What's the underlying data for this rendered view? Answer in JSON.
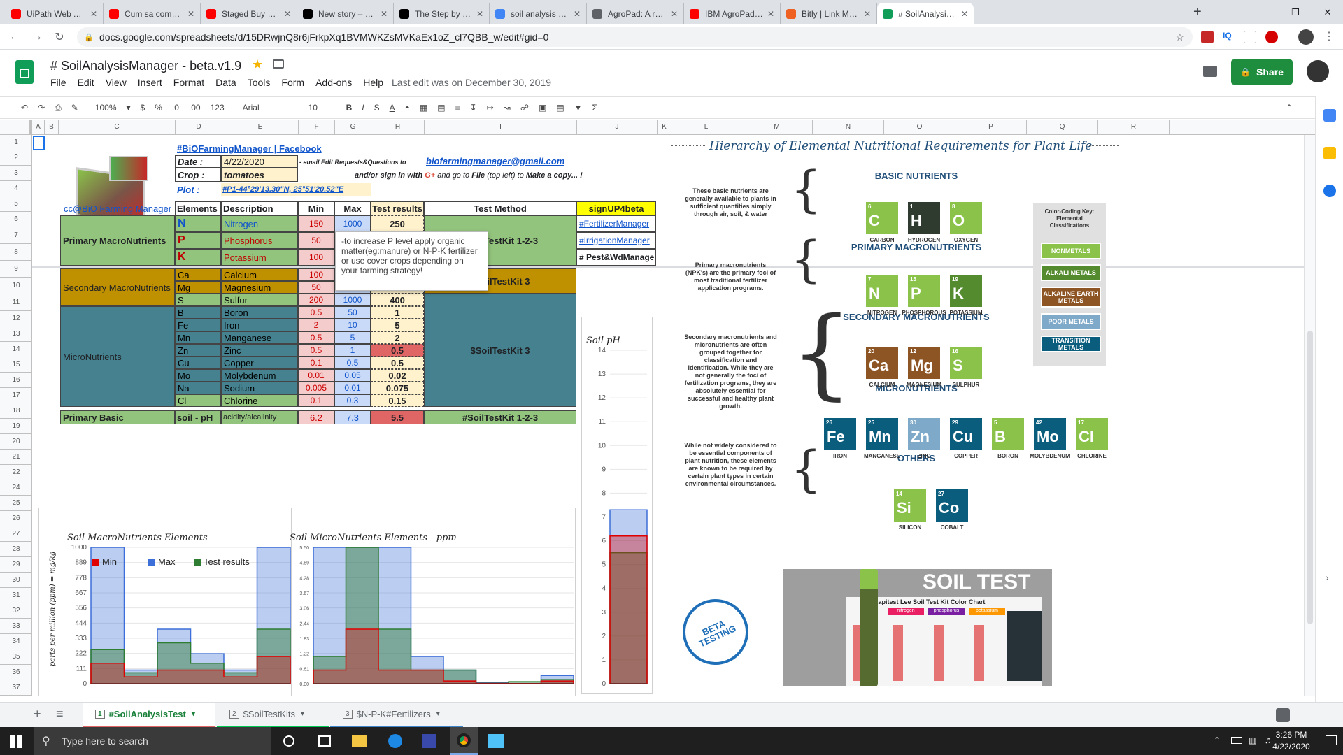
{
  "browser": {
    "tabs": [
      {
        "title": "UiPath Web Autom",
        "icon": "youtube-icon",
        "color": "#ff0000"
      },
      {
        "title": "Cum sa compui Un",
        "icon": "youtube-icon",
        "color": "#ff0000"
      },
      {
        "title": "Staged Buy Out- He",
        "icon": "youtube-icon",
        "color": "#ff0000"
      },
      {
        "title": "New story – Mediur",
        "icon": "medium-icon",
        "color": "#000000"
      },
      {
        "title": "The Step by Step Bl",
        "icon": "medium-icon",
        "color": "#000000"
      },
      {
        "title": "soil analysis – Căuta",
        "icon": "google-icon",
        "color": "#4285f4"
      },
      {
        "title": "AgroPad: A real-tim",
        "icon": "globe-icon",
        "color": "#5f6368"
      },
      {
        "title": "IBM AgroPad - AI-p",
        "icon": "youtube-icon",
        "color": "#ff0000"
      },
      {
        "title": "Bitly | Link Manager",
        "icon": "bitly-icon",
        "color": "#ee6123"
      },
      {
        "title": "# SoilAnalysisMana",
        "icon": "sheets-icon",
        "color": "#0f9d58"
      }
    ],
    "url": "docs.google.com/spreadsheets/d/15DRwjnQ8r6jFrkpXq1BVMWKZsMVKaEx1oZ_cl7QBB_w/edit#gid=0"
  },
  "doc": {
    "title": "# SoilAnalysisManager - beta.v1.9",
    "menus": [
      "File",
      "Edit",
      "View",
      "Insert",
      "Format",
      "Data",
      "Tools",
      "Form",
      "Add-ons",
      "Help"
    ],
    "last_edit": "Last edit was on December 30, 2019",
    "share": "Share"
  },
  "toolbar": {
    "zoom": "100%",
    "currency": "$",
    "percent": "%",
    "dec0": ".0",
    "dec00": ".00",
    "fmt": "123",
    "font": "Arial",
    "size": "10"
  },
  "columns": [
    "A",
    "B",
    "C",
    "D",
    "E",
    "F",
    "G",
    "H",
    "I",
    "J",
    "K",
    "L",
    "M",
    "N",
    "O",
    "P",
    "Q",
    "R"
  ],
  "rows": [
    "1",
    "2",
    "3",
    "4",
    "5",
    "6",
    "7",
    "8",
    "9",
    "10",
    "11",
    "12",
    "13",
    "14",
    "15",
    "16",
    "17",
    "18",
    "19",
    "20",
    "21",
    "22",
    "24",
    "25",
    "26",
    "27",
    "28",
    "29",
    "30",
    "31",
    "32",
    "33",
    "34",
    "35",
    "36",
    "37"
  ],
  "info": {
    "fb": "#BiOFarmingManager | Facebook",
    "date_label": "Date :",
    "date": "4/22/2020",
    "email_note": "- email Edit Requests&Questions to",
    "email": "biofarmingmanager@gmail.com",
    "crop_label": "Crop :",
    "crop": "tomatoes",
    "signin": "and/or sign in with",
    "gplus": "G+",
    "signin2": "and go to",
    "file": "File",
    "signin3": "(top left) to",
    "copy": "Make a copy... !",
    "plot_label": "Plot :",
    "plot": "#P1-44°29'13.30\"N, 25°51'20.52\"E"
  },
  "table": {
    "cc": "cc@BiO Farming Manager",
    "h_el": "Elements",
    "h_desc": "Description",
    "h_min": "Min",
    "h_max": "Max",
    "h_res": "Test results",
    "h_method": "Test Method",
    "signup": "signUP4beta",
    "primary_group": "Primary MacroNutrients",
    "secondary_group": "Secondary MacroNutrients",
    "micro_group": "MicroNutrients",
    "basic_group": "Primary Basic",
    "kit123": "$SoilTestKit 1-2-3",
    "kit3a": "$SoilTestKit 3",
    "kit3b": "$SoilTestKit 3",
    "kitph": "#SoilTestKit 1-2-3",
    "links": [
      "#FertilizerManager",
      "#IrrigationManager",
      "# Pest&WdManager"
    ],
    "rows": [
      {
        "el": "N",
        "desc": "Nitrogen",
        "min": "150",
        "max": "1000",
        "res": "250"
      },
      {
        "el": "P",
        "desc": "Phosphorus",
        "min": "50",
        "max": "",
        "res": ""
      },
      {
        "el": "K",
        "desc": "Potassium",
        "min": "100",
        "max": "",
        "res": ""
      },
      {
        "el": "Ca",
        "desc": "Calcium",
        "min": "100",
        "max": "",
        "res": ""
      },
      {
        "el": "Mg",
        "desc": "Magnesium",
        "min": "50",
        "max": "",
        "res": ""
      },
      {
        "el": "S",
        "desc": "Sulfur",
        "min": "200",
        "max": "1000",
        "res": "400"
      },
      {
        "el": "B",
        "desc": "Boron",
        "min": "0.5",
        "max": "50",
        "res": "1"
      },
      {
        "el": "Fe",
        "desc": "Iron",
        "min": "2",
        "max": "10",
        "res": "5"
      },
      {
        "el": "Mn",
        "desc": "Manganese",
        "min": "0.5",
        "max": "5",
        "res": "2"
      },
      {
        "el": "Zn",
        "desc": "Zinc",
        "min": "0.5",
        "max": "1",
        "res": "0.5"
      },
      {
        "el": "Cu",
        "desc": "Copper",
        "min": "0.1",
        "max": "0.5",
        "res": "0.5"
      },
      {
        "el": "Mo",
        "desc": "Molybdenum",
        "min": "0.01",
        "max": "0.05",
        "res": "0.02"
      },
      {
        "el": "Na",
        "desc": "Sodium",
        "min": "0.005",
        "max": "0.01",
        "res": "0.075"
      },
      {
        "el": "Cl",
        "desc": "Chlorine",
        "min": "0.1",
        "max": "0.3",
        "res": "0.15"
      }
    ],
    "ph": {
      "el": "soil - pH",
      "desc": "acidity/alcalinity",
      "min": "6.2",
      "max": "7.3",
      "res": "5.5"
    }
  },
  "comment": "-to increase P level apply organic matter(eg:manure) or N-P-K fertilizer or use cover crops depending on your farming strategy!",
  "chart_data": [
    {
      "type": "bar",
      "title": "Soil MacroNutrients Elements",
      "ylabel": "parts per million (ppm) = mg/kg",
      "ylim": [
        0,
        1000
      ],
      "yticks": [
        "1000",
        "889",
        "778",
        "667",
        "556",
        "444",
        "333",
        "222",
        "111",
        "0"
      ],
      "series": [
        {
          "name": "Min",
          "color": "#e00000",
          "values": [
            150,
            50,
            100,
            100,
            50,
            200
          ]
        },
        {
          "name": "Max",
          "color": "#3d6fd8",
          "values": [
            1000,
            100,
            400,
            220,
            100,
            1000
          ]
        },
        {
          "name": "Test results",
          "color": "#2e7d32",
          "values": [
            250,
            80,
            300,
            150,
            80,
            400
          ]
        }
      ]
    },
    {
      "type": "bar",
      "title": "Soil MicroNutrients Elements - ppm",
      "ylim": [
        0,
        5
      ],
      "yticks": [
        "5.50",
        "4.89",
        "4.28",
        "3.67",
        "3.06",
        "2.44",
        "1.83",
        "1.22",
        "0.61",
        "0.00"
      ],
      "series": [
        {
          "name": "Min",
          "values": [
            0.5,
            2,
            0.5,
            0.5,
            0.1,
            0.01,
            0.005,
            0.1
          ]
        },
        {
          "name": "Max",
          "values": [
            5.5,
            10,
            5,
            1,
            0.5,
            0.05,
            0.01,
            0.3
          ]
        },
        {
          "name": "Test results",
          "values": [
            1,
            5,
            2,
            0.5,
            0.5,
            0.02,
            0.075,
            0.15
          ]
        }
      ]
    },
    {
      "type": "bar",
      "title": "Soil pH",
      "ylim": [
        0,
        14
      ],
      "yticks": [
        "14",
        "13",
        "12",
        "11",
        "10",
        "9",
        "8",
        "7",
        "6",
        "5",
        "4",
        "3",
        "2",
        "1",
        "0"
      ],
      "series": [
        {
          "name": "Min",
          "values": [
            6.2
          ]
        },
        {
          "name": "Max",
          "values": [
            7.3
          ]
        },
        {
          "name": "Test results",
          "values": [
            5.5
          ]
        }
      ]
    }
  ],
  "infographic": {
    "title": "Hierarchy of Elemental Nutritional Requirements for Plant Life",
    "basic": "BASIC NUTRIENTS",
    "primary": "PRIMARY MACRONUTRIENTS",
    "secondary": "SECONDARY MACRONUTRIENTS",
    "micro": "MICRONUTRIENTS",
    "others": "OTHERS",
    "d1": "These basic nutrients are generally available to plants in sufficient quantities simply through air, soil, & water",
    "d2": "Primary macronutrients (NPK's) are the primary foci of most traditional fertilizer application programs.",
    "d3": "Secondary macronutrients and micronutrients are often grouped together for classification and identification. While they are not generally the foci of fertilization programs, they are absolutely essential for successful and healthy plant growth.",
    "d4": "While not widely considered to be essential components of plant nutrition, these elements are known to be required by certain plant types in certain environmental circumstances.",
    "key_title": "Color-Coding Key: Elemental Classifications",
    "keys": [
      "NONMETALS",
      "ALKALI METALS",
      "ALKALINE EARTH METALS",
      "POOR METALS",
      "TRANSITION METALS"
    ],
    "elements": [
      {
        "n": "6",
        "s": "C",
        "name": "CARBON",
        "color": "#8bc34a"
      },
      {
        "n": "1",
        "s": "H",
        "name": "HYDROGEN",
        "color": "#2e3b2e"
      },
      {
        "n": "8",
        "s": "O",
        "name": "OXYGEN",
        "color": "#8bc34a"
      },
      {
        "n": "7",
        "s": "N",
        "name": "NITROGEN",
        "color": "#8bc34a"
      },
      {
        "n": "15",
        "s": "P",
        "name": "PHOSPHOROUS",
        "color": "#8bc34a"
      },
      {
        "n": "19",
        "s": "K",
        "name": "POTASSIUM",
        "color": "#558b2f"
      },
      {
        "n": "20",
        "s": "Ca",
        "name": "CALCIUM",
        "color": "#8d5524"
      },
      {
        "n": "12",
        "s": "Mg",
        "name": "MAGNESIUM",
        "color": "#8d5524"
      },
      {
        "n": "16",
        "s": "S",
        "name": "SULPHUR",
        "color": "#8bc34a"
      },
      {
        "n": "26",
        "s": "Fe",
        "name": "IRON",
        "color": "#0b5d7e"
      },
      {
        "n": "25",
        "s": "Mn",
        "name": "MANGANESE",
        "color": "#0b5d7e"
      },
      {
        "n": "30",
        "s": "Zn",
        "name": "ZINC",
        "color": "#7fa9c9"
      },
      {
        "n": "29",
        "s": "Cu",
        "name": "COPPER",
        "color": "#0b5d7e"
      },
      {
        "n": "5",
        "s": "B",
        "name": "BORON",
        "color": "#8bc34a"
      },
      {
        "n": "42",
        "s": "Mo",
        "name": "MOLYBDENUM",
        "color": "#0b5d7e"
      },
      {
        "n": "17",
        "s": "Cl",
        "name": "CHLORINE",
        "color": "#8bc34a"
      },
      {
        "n": "14",
        "s": "Si",
        "name": "SILICON",
        "color": "#8bc34a"
      },
      {
        "n": "27",
        "s": "Co",
        "name": "COBALT",
        "color": "#0b5d7e"
      }
    ]
  },
  "soiltest": {
    "title": "SOIL TEST",
    "sub": "Rapitest Lee Soil Test Kit Color Chart",
    "cols": [
      "nitrogen",
      "phosphorus",
      "potassium"
    ],
    "badge": "BETA TESTING"
  },
  "sheets": [
    {
      "num": "1",
      "name": "#SoilAnalysisTest",
      "color": "#e06666"
    },
    {
      "num": "2",
      "name": "$SoilTestKits",
      "color": "#00c853"
    },
    {
      "num": "3",
      "name": "$N-P-K#Fertilizers",
      "color": "#3d85c6"
    }
  ],
  "taskbar": {
    "search": "Type here to search",
    "time": "3:26 PM",
    "date": "4/22/2020"
  }
}
